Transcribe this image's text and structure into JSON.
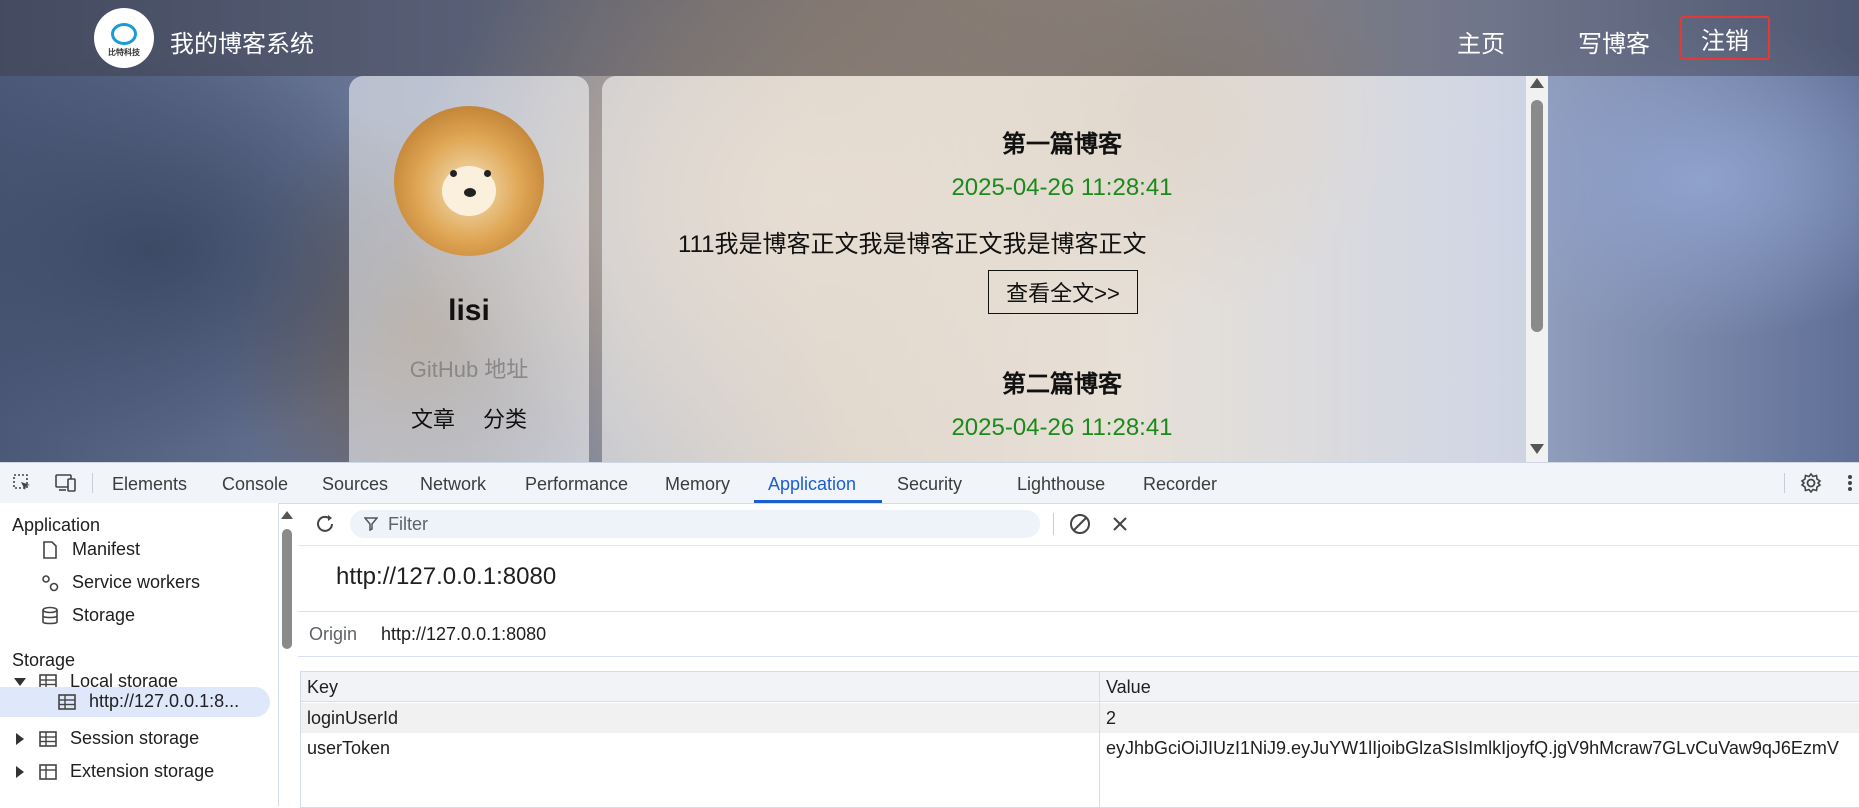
{
  "site": {
    "logo_text": "比特科技",
    "title": "我的博客系统",
    "nav": {
      "home": "主页",
      "write": "写博客",
      "logout": "注销"
    }
  },
  "profile": {
    "username": "lisi",
    "github": "GitHub 地址",
    "articles": "文章",
    "categories": "分类"
  },
  "blogs": [
    {
      "title": "第一篇博客",
      "date": "2025-04-26 11:28:41",
      "body": "111我是博客正文我是博客正文我是博客正文",
      "button": "查看全文>>"
    },
    {
      "title": "第二篇博客",
      "date": "2025-04-26 11:28:41"
    }
  ],
  "devtools": {
    "tabs": [
      "Elements",
      "Console",
      "Sources",
      "Network",
      "Performance",
      "Memory",
      "Application",
      "Security",
      "Lighthouse",
      "Recorder"
    ],
    "active_tab": "Application",
    "sidebar": {
      "application_header": "Application",
      "application_items": [
        "Manifest",
        "Service workers",
        "Storage"
      ],
      "storage_header": "Storage",
      "local_storage": "Local storage",
      "local_storage_origin": "http://127.0.0.1:8...",
      "session_storage": "Session storage",
      "extension_storage": "Extension storage"
    },
    "filter_placeholder": "Filter",
    "origin_title": "http://127.0.0.1:8080",
    "origin_label": "Origin",
    "origin_value": "http://127.0.0.1:8080",
    "table": {
      "headers": [
        "Key",
        "Value"
      ],
      "rows": [
        {
          "key": "loginUserId",
          "value": "2"
        },
        {
          "key": "userToken",
          "value": "eyJhbGciOiJIUzI1NiJ9.eyJuYW1lIjoibGlzaSIsImlkIjoyfQ.jgV9hMcraw7GLvCuVaw9qJ6EzmV"
        }
      ]
    }
  }
}
